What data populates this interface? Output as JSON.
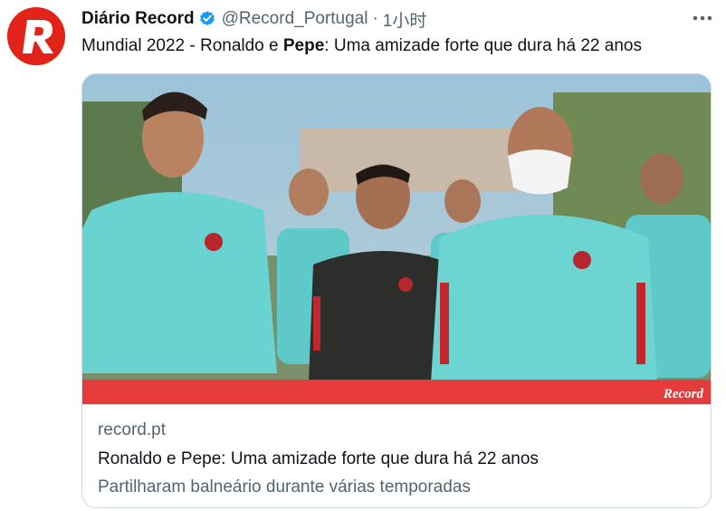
{
  "author": {
    "display_name": "Diário Record",
    "handle": "@Record_Portugal",
    "separator": "·",
    "timestamp": "1小时",
    "avatar_letter": "R",
    "avatar_color": "#e2231a",
    "verified_color": "#1d9bf0"
  },
  "tweet": {
    "text_before": "Mundial 2022 - Ronaldo e ",
    "text_bold": "Pepe",
    "text_after": ": Uma amizade forte que dura há 22 anos"
  },
  "card": {
    "image_brand": "Record",
    "domain": "record.pt",
    "title": "Ronaldo e Pepe: Uma amizade forte que dura há 22 anos",
    "description": "Partilharam balneário durante várias temporadas"
  },
  "icons": {
    "more": "more-horizontal-icon",
    "verified": "verified-badge-icon",
    "logo": "record-logo-icon"
  }
}
